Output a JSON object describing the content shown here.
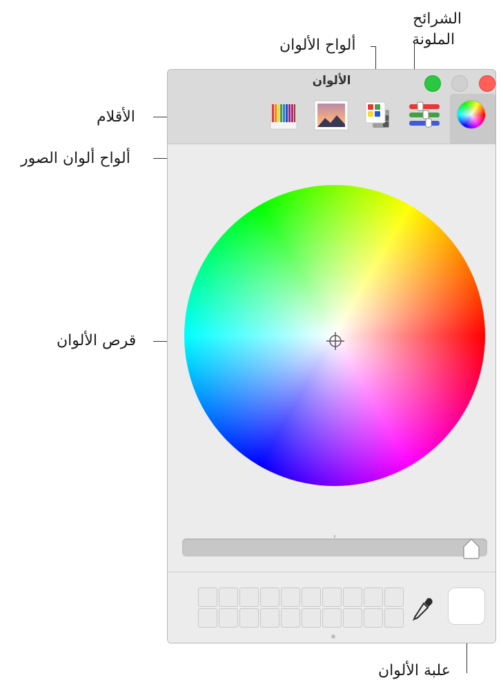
{
  "window": {
    "title": "الألوان"
  },
  "toolbar": {
    "tabs": [
      {
        "id": "pencils",
        "icon": "pencils-icon"
      },
      {
        "id": "image-palettes",
        "icon": "image-palette-icon"
      },
      {
        "id": "color-palettes",
        "icon": "color-palette-icon"
      },
      {
        "id": "color-sliders",
        "icon": "sliders-icon"
      },
      {
        "id": "color-wheel",
        "icon": "color-wheel-icon",
        "selected": true
      }
    ]
  },
  "callouts": {
    "color_sliders_line1": "الشرائح",
    "color_sliders_line2": "الملونة",
    "color_palettes": "ألواح الألوان",
    "pencils": "الأقلام",
    "image_palettes": "ألواح ألوان الصور",
    "color_wheel": "قرص الألوان",
    "color_well": "علبة الألوان"
  },
  "brightness": 1.0,
  "colors": {
    "close": "#ff5f57",
    "minimize": "#d0d0d0",
    "zoom": "#28c840",
    "well": "#ffffff"
  }
}
